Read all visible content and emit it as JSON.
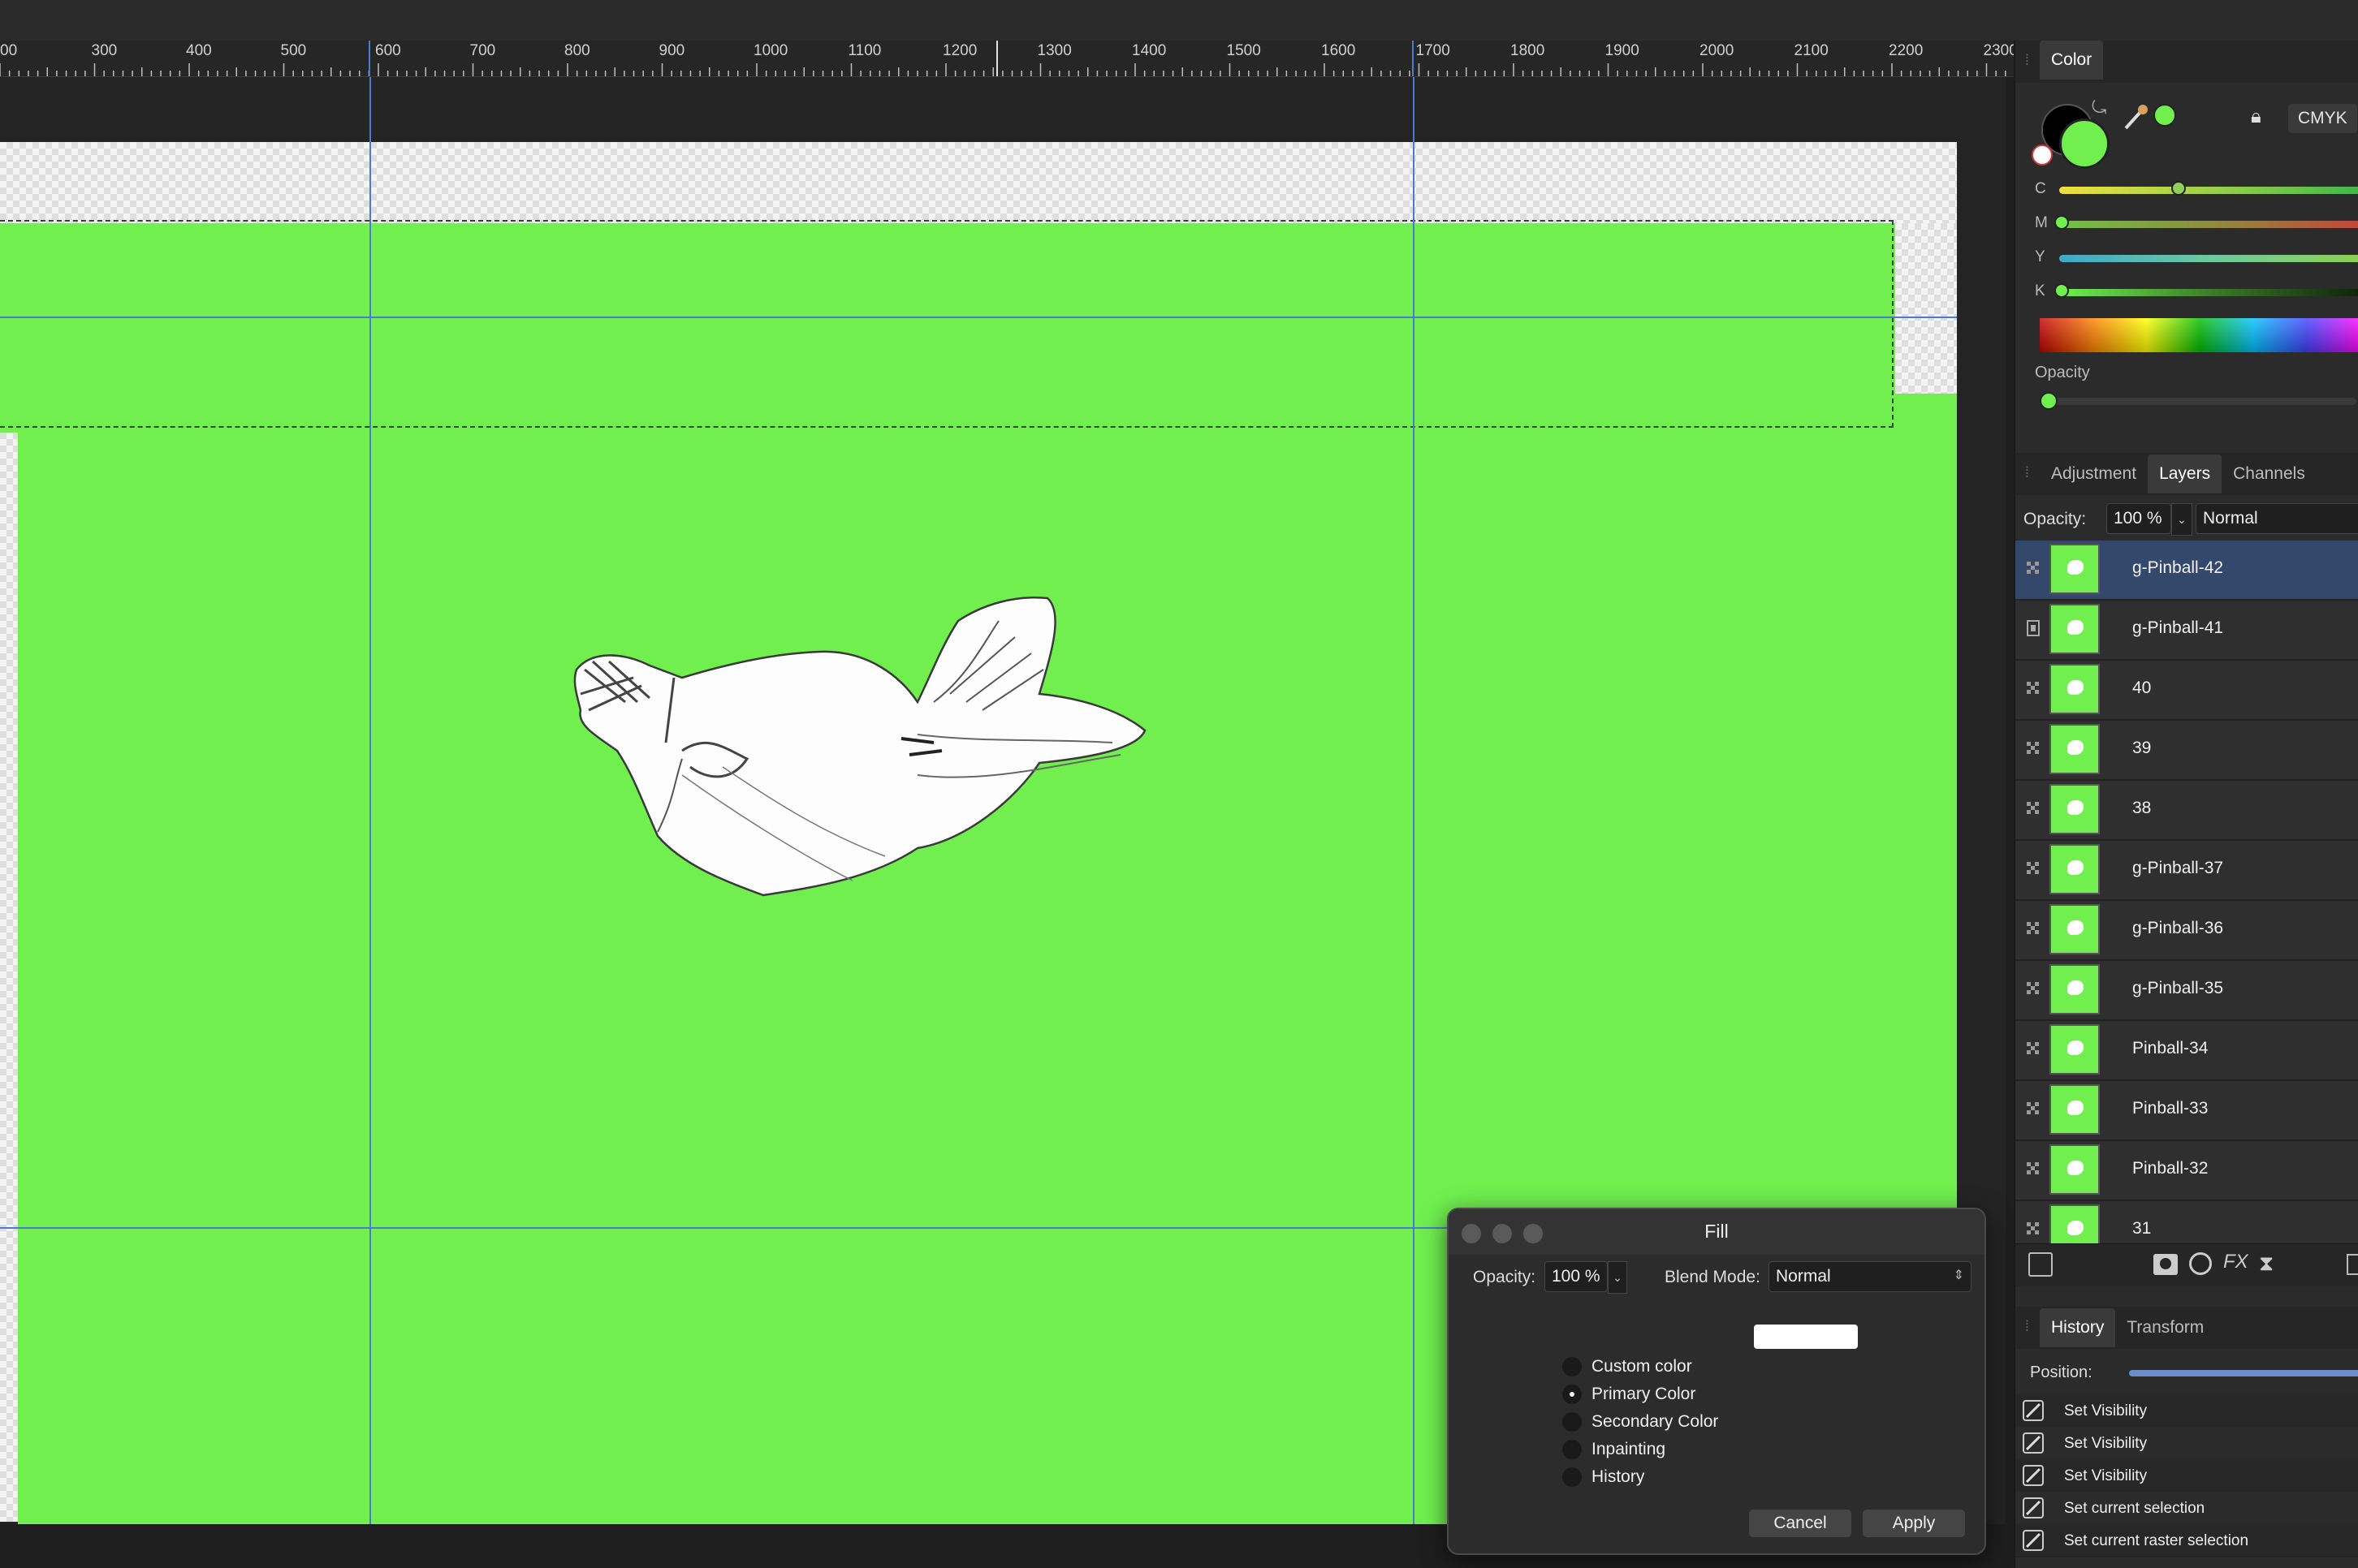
{
  "ruler": {
    "labels": [
      "00",
      "300",
      "400",
      "500",
      "600",
      "700",
      "800",
      "900",
      "1000",
      "1100",
      "1200",
      "1300",
      "1400",
      "1500",
      "1600",
      "1700",
      "1800",
      "1900",
      "2000",
      "2100",
      "2200",
      "2300"
    ]
  },
  "colors": {
    "canvas_fill": "#70ef4f",
    "guide": "#4a7bd1",
    "selected_layer": "#33486a",
    "primary_color": "#70ef4f",
    "secondary_color": "#000000"
  },
  "color_panel": {
    "tab": "Color",
    "mode_button": "CMYK",
    "channels": [
      {
        "label": "C",
        "value": 0.38
      },
      {
        "label": "M",
        "value": 0.0
      },
      {
        "label": "Y",
        "value": 1.0
      },
      {
        "label": "K",
        "value": 0.0
      }
    ],
    "opacity_label": "Opacity",
    "opacity_value": 0.0
  },
  "layers_panel": {
    "tabs": [
      "Adjustment",
      "Layers",
      "Channels"
    ],
    "active_tab": "Layers",
    "opacity_label": "Opacity:",
    "opacity_value": "100 %",
    "blend_mode": "Normal",
    "layers": [
      {
        "name": "g-Pinball-42",
        "selected": true
      },
      {
        "name": "g-Pinball-41",
        "selected": false
      },
      {
        "name": "40",
        "selected": false
      },
      {
        "name": "39",
        "selected": false
      },
      {
        "name": "38",
        "selected": false
      },
      {
        "name": "g-Pinball-37",
        "selected": false
      },
      {
        "name": "g-Pinball-36",
        "selected": false
      },
      {
        "name": "g-Pinball-35",
        "selected": false
      },
      {
        "name": "Pinball-34",
        "selected": false
      },
      {
        "name": "Pinball-33",
        "selected": false
      },
      {
        "name": "Pinball-32",
        "selected": false
      },
      {
        "name": "31",
        "selected": false
      }
    ]
  },
  "history_panel": {
    "tabs": [
      "History",
      "Transform"
    ],
    "active_tab": "History",
    "position_label": "Position:",
    "items": [
      "Set Visibility",
      "Set Visibility",
      "Set Visibility",
      "Set current selection",
      "Set current raster selection"
    ]
  },
  "fill_dialog": {
    "title": "Fill",
    "opacity_label": "Opacity:",
    "opacity_value": "100 %",
    "blend_mode_label": "Blend Mode:",
    "blend_mode_value": "Normal",
    "options": [
      {
        "label": "Custom color",
        "selected": false
      },
      {
        "label": "Primary Color",
        "selected": true
      },
      {
        "label": "Secondary Color",
        "selected": false
      },
      {
        "label": "Inpainting",
        "selected": false
      },
      {
        "label": "History",
        "selected": false
      }
    ],
    "custom_color_swatch": "#ffffff",
    "cancel_label": "Cancel",
    "apply_label": "Apply"
  }
}
